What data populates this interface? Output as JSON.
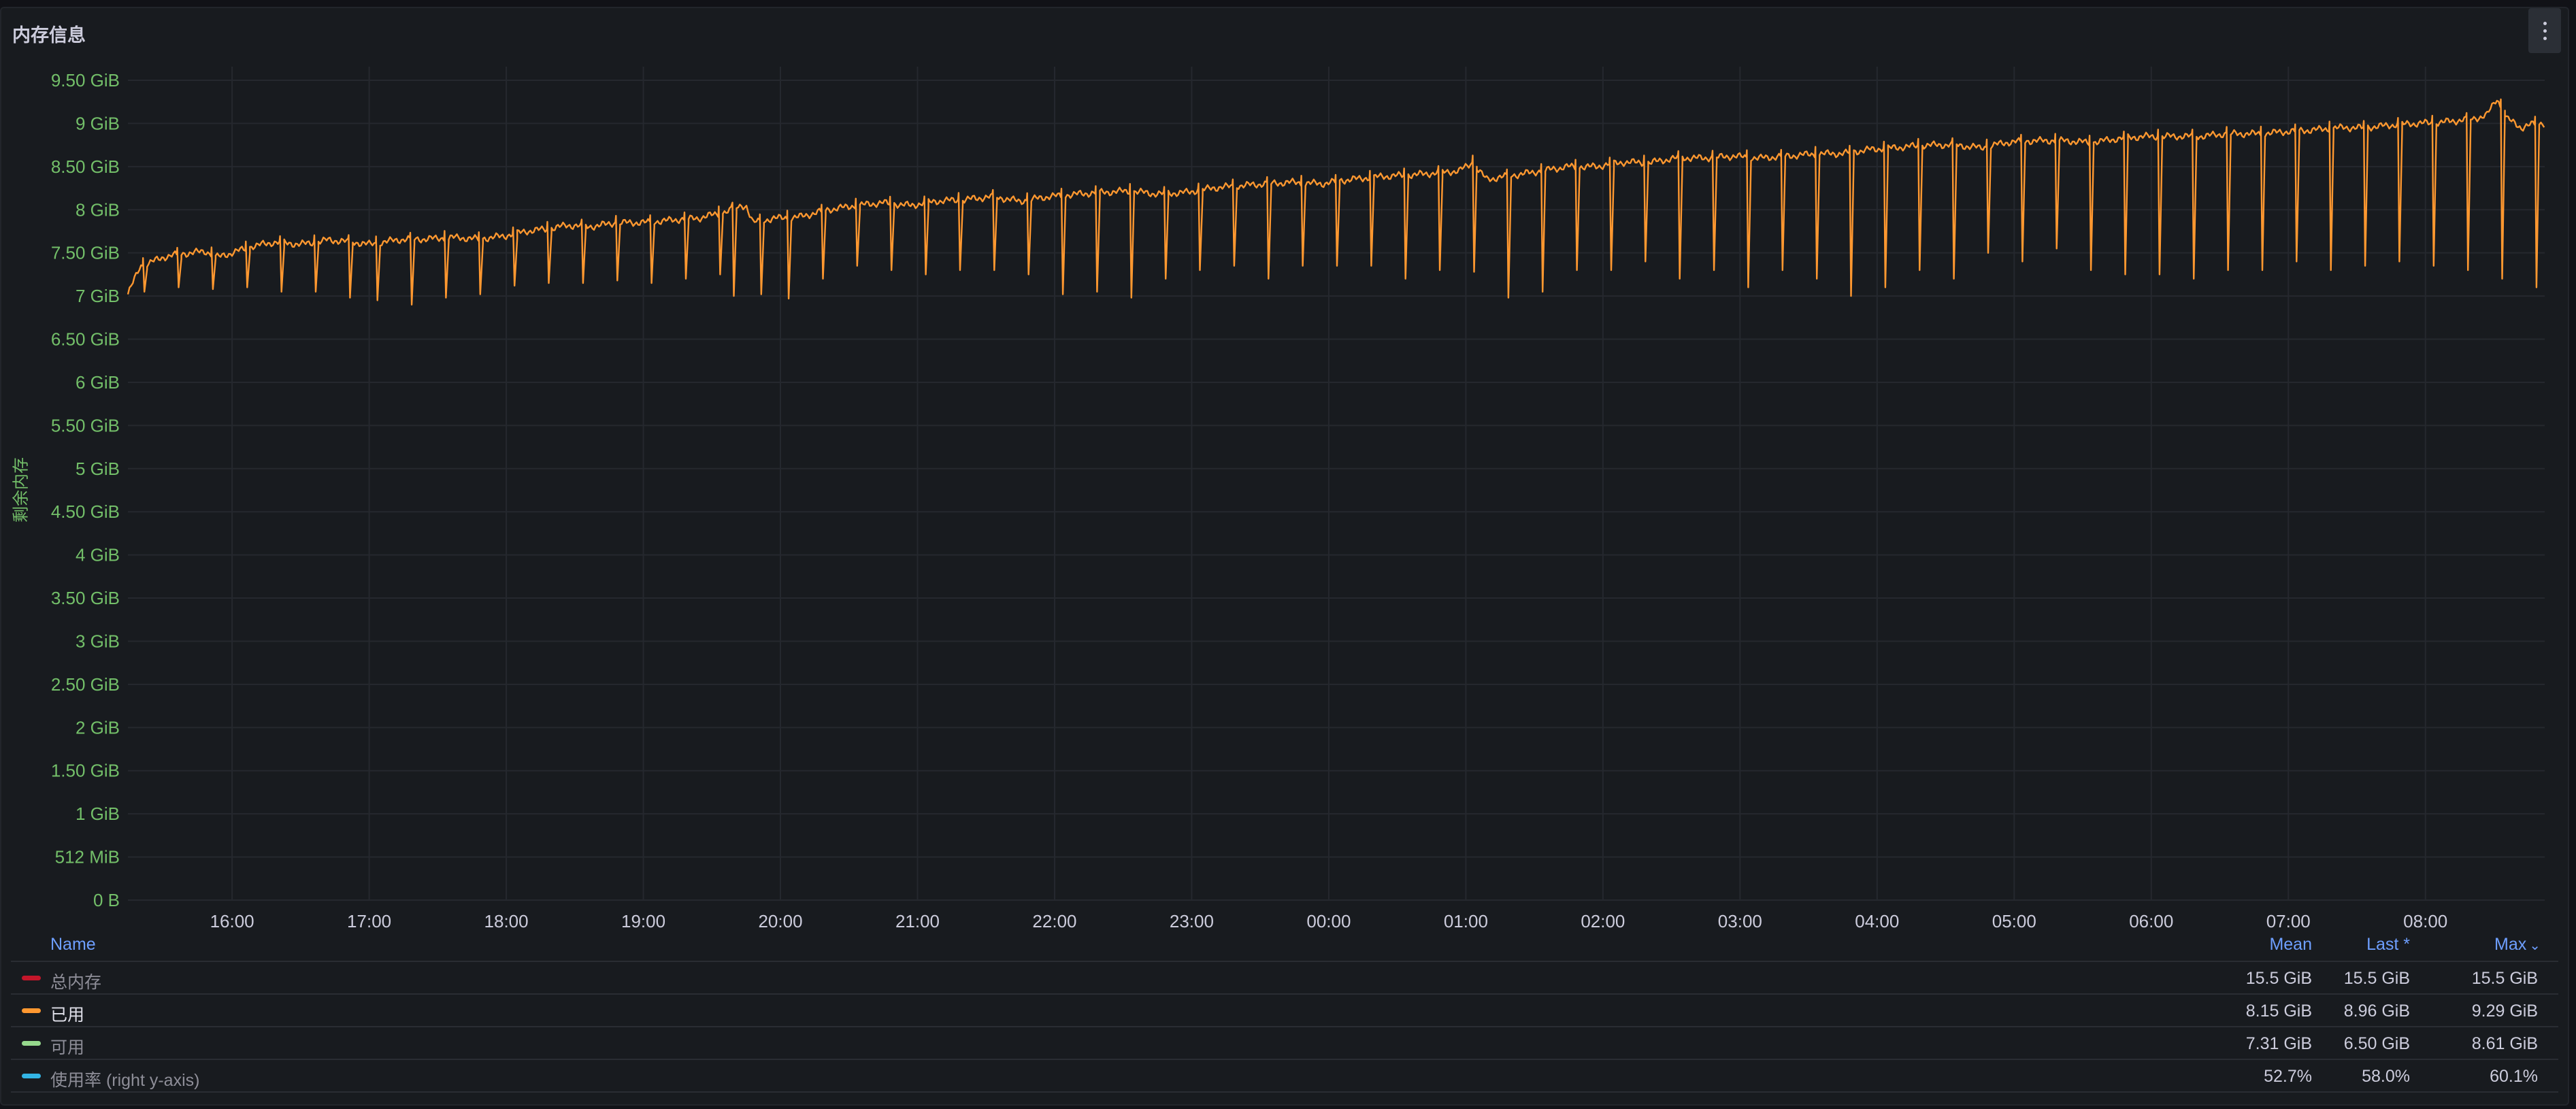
{
  "panel": {
    "title": "内存信息",
    "menu_icon": "kebab-menu-icon"
  },
  "legend": {
    "headers": {
      "name": "Name",
      "mean": "Mean",
      "last": "Last *",
      "max": "Max"
    },
    "sort_indicator": "⌄",
    "rows": [
      {
        "name": "总内存",
        "color": "#c4162a",
        "mean": "15.5 GiB",
        "last": "15.5 GiB",
        "max": "15.5 GiB",
        "active": false
      },
      {
        "name": "已用",
        "color": "#ff9830",
        "mean": "8.15 GiB",
        "last": "8.96 GiB",
        "max": "9.29 GiB",
        "active": true
      },
      {
        "name": "可用",
        "color": "#96d98d",
        "mean": "7.31 GiB",
        "last": "6.50 GiB",
        "max": "8.61 GiB",
        "active": false
      },
      {
        "name": "使用率 (right y-axis)",
        "color": "#33b5e5",
        "mean": "52.7%",
        "last": "58.0%",
        "max": "60.1%",
        "active": false
      }
    ]
  },
  "chart_data": {
    "type": "line",
    "ylabel": "剩余内存",
    "ylim": [
      0,
      9.5
    ],
    "y_unit": "GiB",
    "y_ticks": [
      {
        "value": 0,
        "label": "0 B"
      },
      {
        "value": 0.5,
        "label": "512 MiB"
      },
      {
        "value": 1,
        "label": "1 GiB"
      },
      {
        "value": 1.5,
        "label": "1.50 GiB"
      },
      {
        "value": 2,
        "label": "2 GiB"
      },
      {
        "value": 2.5,
        "label": "2.50 GiB"
      },
      {
        "value": 3,
        "label": "3 GiB"
      },
      {
        "value": 3.5,
        "label": "3.50 GiB"
      },
      {
        "value": 4,
        "label": "4 GiB"
      },
      {
        "value": 4.5,
        "label": "4.50 GiB"
      },
      {
        "value": 5,
        "label": "5 GiB"
      },
      {
        "value": 5.5,
        "label": "5.50 GiB"
      },
      {
        "value": 6,
        "label": "6 GiB"
      },
      {
        "value": 6.5,
        "label": "6.50 GiB"
      },
      {
        "value": 7,
        "label": "7 GiB"
      },
      {
        "value": 7.5,
        "label": "7.50 GiB"
      },
      {
        "value": 8,
        "label": "8 GiB"
      },
      {
        "value": 8.5,
        "label": "8.50 GiB"
      },
      {
        "value": 9,
        "label": "9 GiB"
      },
      {
        "value": 9.5,
        "label": "9.50 GiB"
      }
    ],
    "x_ticks": [
      "16:00",
      "17:00",
      "18:00",
      "19:00",
      "20:00",
      "21:00",
      "22:00",
      "23:00",
      "00:00",
      "01:00",
      "02:00",
      "03:00",
      "04:00",
      "05:00",
      "06:00",
      "07:00",
      "08:00"
    ],
    "x_range_hours": [
      15.24,
      32.87
    ],
    "grid": true,
    "series": [
      {
        "name": "已用",
        "color": "#ff9830",
        "points": [
          [
            15.24,
            7.02
          ],
          [
            15.33,
            7.35
          ],
          [
            15.42,
            7.4
          ],
          [
            15.5,
            7.45
          ],
          [
            15.6,
            7.48
          ],
          [
            15.7,
            7.5
          ],
          [
            15.8,
            7.52
          ],
          [
            15.9,
            7.45
          ],
          [
            16.0,
            7.5
          ],
          [
            16.15,
            7.58
          ],
          [
            16.3,
            7.62
          ],
          [
            16.5,
            7.6
          ],
          [
            16.7,
            7.65
          ],
          [
            16.9,
            7.62
          ],
          [
            17.0,
            7.6
          ],
          [
            17.2,
            7.65
          ],
          [
            17.4,
            7.66
          ],
          [
            17.6,
            7.68
          ],
          [
            17.8,
            7.66
          ],
          [
            18.0,
            7.7
          ],
          [
            18.15,
            7.75
          ],
          [
            18.3,
            7.78
          ],
          [
            18.45,
            7.82
          ],
          [
            18.6,
            7.8
          ],
          [
            18.8,
            7.85
          ],
          [
            19.0,
            7.85
          ],
          [
            19.2,
            7.88
          ],
          [
            19.4,
            7.9
          ],
          [
            19.6,
            7.98
          ],
          [
            19.75,
            8.05
          ],
          [
            19.8,
            7.85
          ],
          [
            19.95,
            7.9
          ],
          [
            20.15,
            7.92
          ],
          [
            20.35,
            8.0
          ],
          [
            20.55,
            8.05
          ],
          [
            20.75,
            8.08
          ],
          [
            20.95,
            8.05
          ],
          [
            21.15,
            8.1
          ],
          [
            21.35,
            8.12
          ],
          [
            21.55,
            8.15
          ],
          [
            21.75,
            8.1
          ],
          [
            21.95,
            8.15
          ],
          [
            22.15,
            8.18
          ],
          [
            22.35,
            8.2
          ],
          [
            22.55,
            8.22
          ],
          [
            22.75,
            8.18
          ],
          [
            22.95,
            8.2
          ],
          [
            23.15,
            8.25
          ],
          [
            23.35,
            8.28
          ],
          [
            23.55,
            8.3
          ],
          [
            23.75,
            8.32
          ],
          [
            23.95,
            8.3
          ],
          [
            24.15,
            8.35
          ],
          [
            24.35,
            8.38
          ],
          [
            24.55,
            8.4
          ],
          [
            24.75,
            8.42
          ],
          [
            24.95,
            8.45
          ],
          [
            25.05,
            8.55
          ],
          [
            25.15,
            8.35
          ],
          [
            25.35,
            8.4
          ],
          [
            25.55,
            8.45
          ],
          [
            25.75,
            8.5
          ],
          [
            25.95,
            8.5
          ],
          [
            26.15,
            8.55
          ],
          [
            26.35,
            8.55
          ],
          [
            26.55,
            8.6
          ],
          [
            26.75,
            8.6
          ],
          [
            26.95,
            8.62
          ],
          [
            27.15,
            8.6
          ],
          [
            27.35,
            8.62
          ],
          [
            27.55,
            8.65
          ],
          [
            27.75,
            8.65
          ],
          [
            27.95,
            8.7
          ],
          [
            28.15,
            8.72
          ],
          [
            28.35,
            8.75
          ],
          [
            28.55,
            8.75
          ],
          [
            28.75,
            8.72
          ],
          [
            28.95,
            8.78
          ],
          [
            29.15,
            8.8
          ],
          [
            29.35,
            8.8
          ],
          [
            29.55,
            8.78
          ],
          [
            29.75,
            8.82
          ],
          [
            29.95,
            8.85
          ],
          [
            30.15,
            8.85
          ],
          [
            30.35,
            8.85
          ],
          [
            30.55,
            8.88
          ],
          [
            30.75,
            8.88
          ],
          [
            30.95,
            8.9
          ],
          [
            31.15,
            8.92
          ],
          [
            31.35,
            8.95
          ],
          [
            31.55,
            8.95
          ],
          [
            31.75,
            8.98
          ],
          [
            31.95,
            9.0
          ],
          [
            32.15,
            9.02
          ],
          [
            32.35,
            9.05
          ],
          [
            32.45,
            9.1
          ],
          [
            32.52,
            9.29
          ],
          [
            32.6,
            9.05
          ],
          [
            32.7,
            8.95
          ],
          [
            32.8,
            9.0
          ],
          [
            32.87,
            9.0
          ]
        ],
        "dips": [
          [
            15.35,
            7.05
          ],
          [
            15.6,
            7.1
          ],
          [
            15.85,
            7.08
          ],
          [
            16.1,
            7.1
          ],
          [
            16.35,
            7.05
          ],
          [
            16.6,
            7.05
          ],
          [
            16.85,
            6.98
          ],
          [
            17.05,
            6.95
          ],
          [
            17.3,
            6.9
          ],
          [
            17.55,
            6.98
          ],
          [
            17.8,
            7.02
          ],
          [
            18.05,
            7.12
          ],
          [
            18.3,
            7.15
          ],
          [
            18.55,
            7.15
          ],
          [
            18.8,
            7.18
          ],
          [
            19.05,
            7.15
          ],
          [
            19.3,
            7.2
          ],
          [
            19.55,
            7.25
          ],
          [
            19.65,
            7.0
          ],
          [
            19.85,
            7.02
          ],
          [
            20.05,
            6.97
          ],
          [
            20.3,
            7.2
          ],
          [
            20.55,
            7.35
          ],
          [
            20.8,
            7.3
          ],
          [
            21.05,
            7.25
          ],
          [
            21.3,
            7.3
          ],
          [
            21.55,
            7.3
          ],
          [
            21.8,
            7.25
          ],
          [
            22.05,
            7.02
          ],
          [
            22.3,
            7.05
          ],
          [
            22.55,
            6.98
          ],
          [
            22.8,
            7.2
          ],
          [
            23.05,
            7.3
          ],
          [
            23.3,
            7.35
          ],
          [
            23.55,
            7.2
          ],
          [
            23.8,
            7.35
          ],
          [
            24.05,
            7.35
          ],
          [
            24.3,
            7.35
          ],
          [
            24.55,
            7.2
          ],
          [
            24.8,
            7.3
          ],
          [
            25.05,
            7.28
          ],
          [
            25.3,
            6.98
          ],
          [
            25.55,
            7.05
          ],
          [
            25.8,
            7.3
          ],
          [
            26.05,
            7.3
          ],
          [
            26.3,
            7.4
          ],
          [
            26.55,
            7.2
          ],
          [
            26.8,
            7.3
          ],
          [
            27.05,
            7.1
          ],
          [
            27.3,
            7.3
          ],
          [
            27.55,
            7.2
          ],
          [
            27.8,
            7.0
          ],
          [
            28.05,
            7.1
          ],
          [
            28.3,
            7.3
          ],
          [
            28.55,
            7.2
          ],
          [
            28.8,
            7.5
          ],
          [
            29.05,
            7.4
          ],
          [
            29.3,
            7.55
          ],
          [
            29.55,
            7.3
          ],
          [
            29.8,
            7.25
          ],
          [
            30.05,
            7.25
          ],
          [
            30.3,
            7.2
          ],
          [
            30.55,
            7.3
          ],
          [
            30.8,
            7.3
          ],
          [
            31.05,
            7.4
          ],
          [
            31.3,
            7.3
          ],
          [
            31.55,
            7.35
          ],
          [
            31.8,
            7.4
          ],
          [
            32.05,
            7.35
          ],
          [
            32.3,
            7.3
          ],
          [
            32.55,
            7.2
          ],
          [
            32.8,
            7.1
          ]
        ]
      }
    ]
  }
}
